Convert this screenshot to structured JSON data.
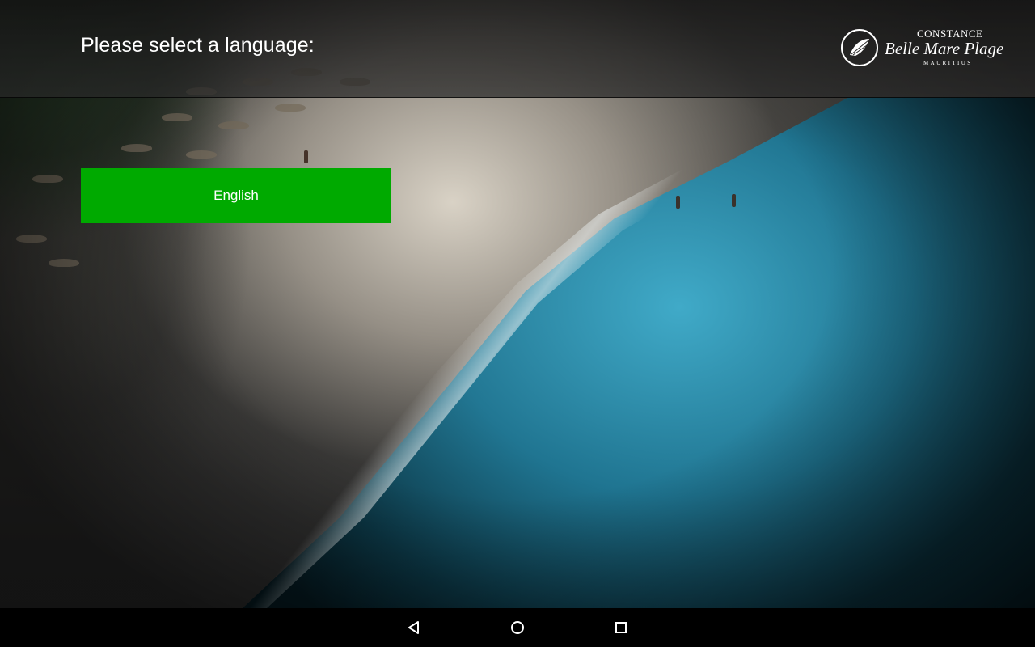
{
  "header": {
    "title": "Please select a language:"
  },
  "logo": {
    "top_text": "CONSTANCE",
    "main_text": "Belle Mare Plage",
    "sub_text": "MAURITIUS"
  },
  "languages": [
    {
      "label": "English"
    }
  ],
  "navbar": {
    "back_icon": "back-triangle-icon",
    "home_icon": "home-circle-icon",
    "recents_icon": "recents-square-icon"
  },
  "colors": {
    "button_green": "#00aa00",
    "header_bg": "#2a2a2a",
    "text": "#ffffff"
  }
}
